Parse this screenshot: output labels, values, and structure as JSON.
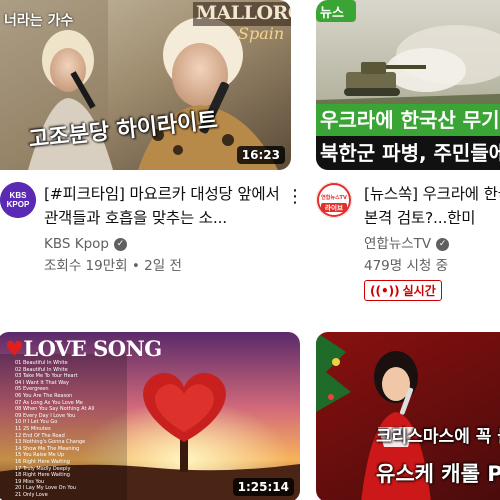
{
  "videos": [
    {
      "thumb_title_top": "MALLORCA",
      "thumb_title_script": "Spain",
      "thumb_caption_left": "너라는 가수",
      "thumb_caption_bottom": "고조분당 하이라이트",
      "duration": "16:23",
      "avatar_text": "KBS\nKPOP",
      "title": "[#피크타임] 마요르카 대성당 앞에서 관객들과 호흡을 맞추는 소...",
      "channel": "KBS Kpop",
      "views": "조회수 19만회",
      "age": "2일 전"
    },
    {
      "thumb_badge": "뉴스",
      "thumb_banner_1": "우크라에 한국산 무기",
      "thumb_banner_2": "북한군 파병, 주민들에",
      "avatar_text": "연합뉴스TV",
      "avatar_label": "라이브",
      "title": "[뉴스쏙] 우크라에 한국산 무기 지원 본격 검토?...한미",
      "channel": "연합뉴스TV",
      "stats": "479명 시청 중",
      "live_label": "실시간"
    },
    {
      "thumb_title": "LOVE SONG",
      "tracklist": [
        "01 Beautiful In White",
        "02 Beautiful In White",
        "03 Take Me To Your Heart",
        "04 I Want It That Way",
        "05 Evergreen",
        "06 You Are The Reason",
        "07 As Long As You Love Me",
        "08 When You Say Nothing At All",
        "09 Every Day I Love You",
        "10 If I Let You Go",
        "11 25 Minutes",
        "12 End Of The Road",
        "13 Nothing's Gonna Change",
        "14 Show Me The Meaning",
        "15 You Raise Me Up",
        "16 Right Here Waiting",
        "17 Truly Madly Deeply",
        "18 Right Here Waiting",
        "19 Miss You",
        "20 I Lay My Love On You",
        "21 Only Love"
      ],
      "duration": "1:25:14"
    },
    {
      "thumb_caption_1": "크리스마스에 꼭 들",
      "thumb_caption_2": "유스케 캐롤 P"
    }
  ]
}
